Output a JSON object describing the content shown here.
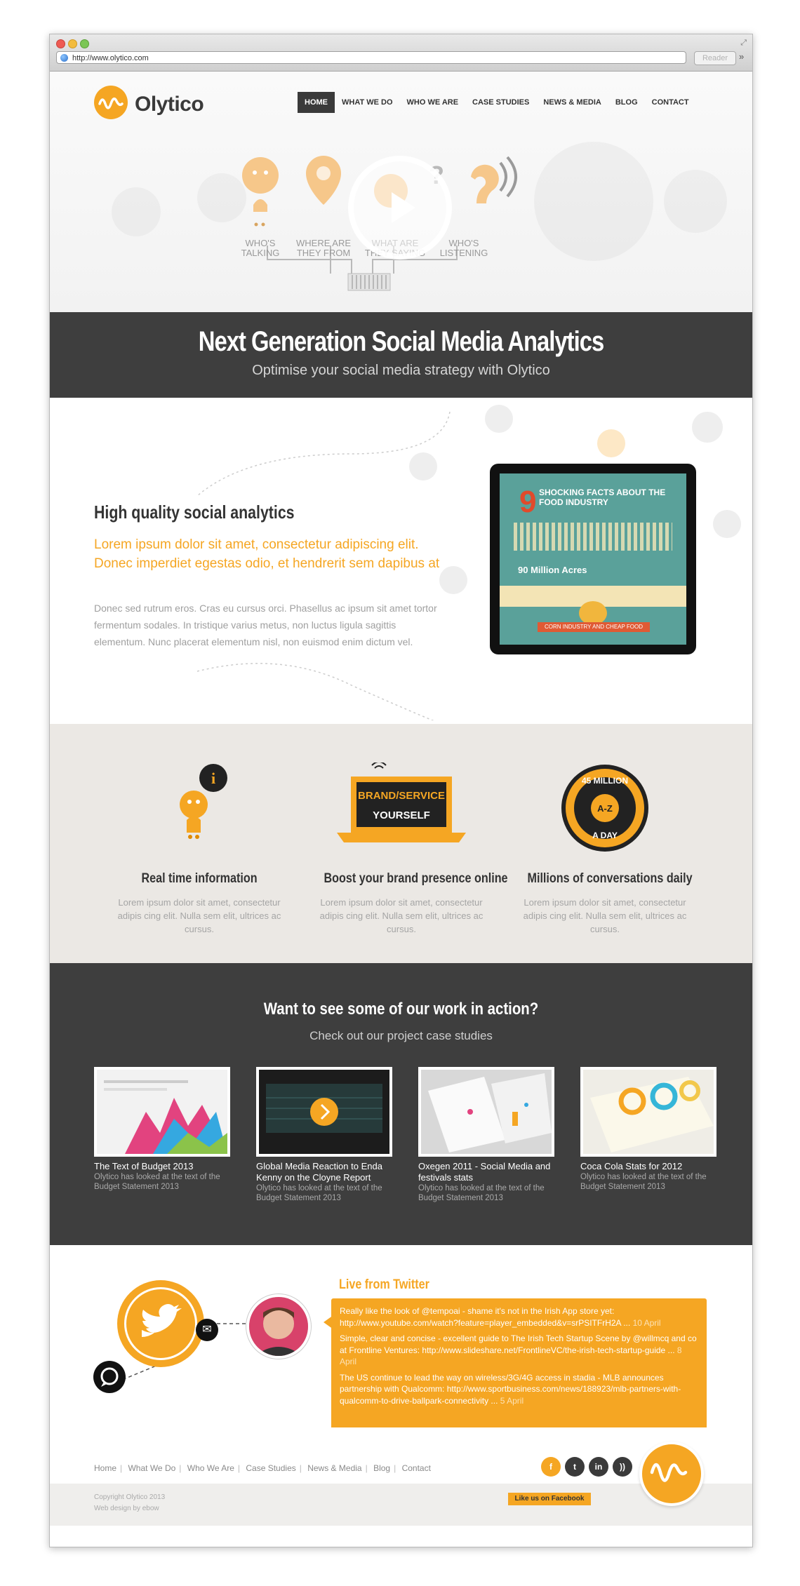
{
  "browser": {
    "url": "http://www.olytico.com",
    "reader_label": "Reader"
  },
  "header": {
    "logo_text": "Olytico",
    "nav": [
      "HOME",
      "WHAT WE DO",
      "WHO WE ARE",
      "CASE STUDIES",
      "NEWS & MEDIA",
      "BLOG",
      "CONTACT"
    ]
  },
  "hero": {
    "labels": [
      "WHO'S TALKING",
      "WHERE ARE THEY FROM",
      "WHAT ARE THEY SAYING",
      "WHO'S LISTENING"
    ]
  },
  "banner": {
    "title": "Next Generation Social Media Analytics",
    "subtitle": "Optimise your social media strategy with Olytico"
  },
  "feature": {
    "title": "High quality social analytics",
    "lead": "Lorem ipsum dolor sit amet, consectetur adipiscing elit. Donec imperdiet egestas odio, et hendrerit sem dapibus at",
    "body": "Donec sed rutrum eros. Cras eu cursus orci. Phasellus ac ipsum sit amet tortor fermentum sodales. In tristique varius metus, non luctus ligula sagittis elementum. Nunc placerat elementum nisl, non euismod enim dictum vel.",
    "tablet": {
      "number": "9",
      "heading": "SHOCKING FACTS ABOUT THE FOOD INDUSTRY",
      "acres": "90 Million Acres",
      "ribbon": "CORN INDUSTRY AND CHEAP FOOD"
    }
  },
  "columns": [
    {
      "title": "Real time information",
      "text": "Lorem ipsum dolor sit amet, consectetur adipis cing elit. Nulla sem elit, ultrices ac cursus.",
      "icon": "i"
    },
    {
      "title": "Boost your brand presence online",
      "text": "Lorem ipsum dolor sit amet, consectetur adipis cing elit. Nulla sem elit, ultrices ac cursus.",
      "icon_line1": "BRAND/SERVICE",
      "icon_line2": "YOURSELF"
    },
    {
      "title": "Millions of conversations daily",
      "text": "Lorem ipsum dolor sit amet, consectetur adipis cing elit. Nulla sem elit, ultrices ac cursus.",
      "badge_top": "45 MILLION",
      "badge_mid": "A-Z",
      "badge_bottom": "A DAY"
    }
  ],
  "cases": {
    "title": "Want to see some of our work in action?",
    "subtitle": "Check out our project case studies",
    "items": [
      {
        "name": "The Text of Budget 2013",
        "desc": "Olytico has looked at the text of the Budget Statement 2013"
      },
      {
        "name": "Global Media Reaction to Enda Kenny on the Cloyne Report",
        "desc": "Olytico has looked at the text of the Budget Statement 2013"
      },
      {
        "name": "Oxegen 2011 - Social Media and festivals stats",
        "desc": "Olytico has looked at the text of the Budget Statement 2013"
      },
      {
        "name": "Coca Cola Stats for 2012",
        "desc": "Olytico has looked at the text of the Budget Statement 2013"
      }
    ]
  },
  "twitter": {
    "title": "Live from Twitter",
    "tweets": [
      {
        "text": "Really like the look of @tempoai - shame it's not in the Irish App store yet: http://www.youtube.com/watch?feature=player_embedded&v=srPSITFrH2A ...",
        "date": "10 April"
      },
      {
        "text": "Simple, clear and concise - excellent guide to The Irish Tech Startup Scene by @willmcq and co at Frontline Ventures: http://www.slideshare.net/FrontlineVC/the-irish-tech-startup-guide ...",
        "date": "8 April"
      },
      {
        "text": "The US continue to lead the way on wireless/3G/4G access in stadia - MLB announces partnership with Qualcomm: http://www.sportbusiness.com/news/188923/mlb-partners-with-qualcomm-to-drive-ballpark-connectivity ...",
        "date": "5 April"
      }
    ]
  },
  "footer": {
    "links": [
      "Home",
      "What We Do",
      "Who We Are",
      "Case Studies",
      "News & Media",
      "Blog",
      "Contact"
    ],
    "like_label": "Like us on Facebook",
    "copyright": "Copyright Olytico 2013",
    "credit": "Web design by ebow"
  },
  "colors": {
    "accent": "#f5a623",
    "dark": "#3e3e3e",
    "light_bg": "#ebe8e4"
  }
}
